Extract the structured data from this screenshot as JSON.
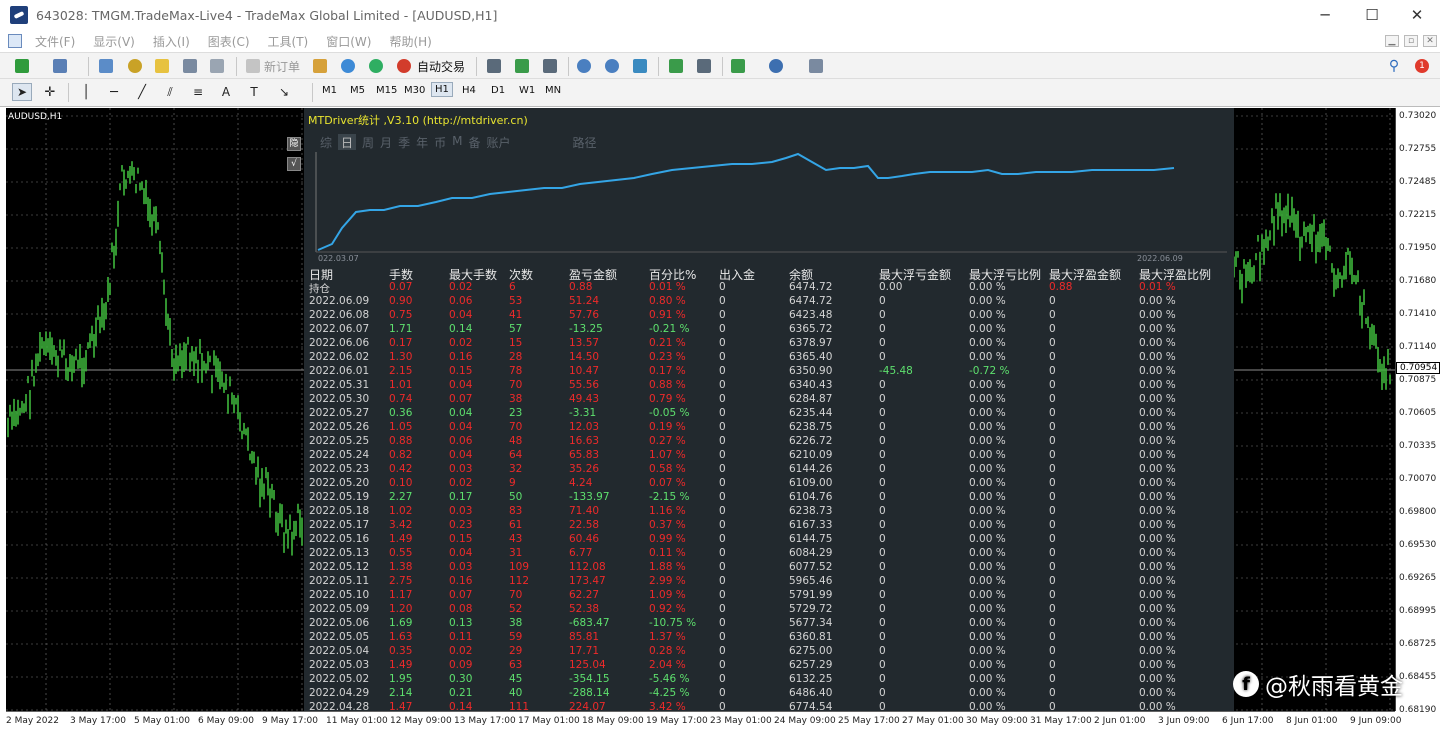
{
  "window": {
    "title": "643028: TMGM.TradeMax-Live4 - TradeMax Global Limited - [AUDUSD,H1]",
    "min": "─",
    "max": "☐",
    "close": "✕"
  },
  "menu": [
    "文件(F)",
    "显示(V)",
    "插入(I)",
    "图表(C)",
    "工具(T)",
    "窗口(W)",
    "帮助(H)"
  ],
  "toolbar": {
    "new_order": "新订单",
    "auto_trade": "自动交易",
    "notif_count": "1"
  },
  "timeframes": [
    "M1",
    "M5",
    "M15",
    "M30",
    "H1",
    "H4",
    "D1",
    "W1",
    "MN"
  ],
  "active_timeframe": "H1",
  "chart": {
    "symbol": "AUDUSD,H1",
    "current_price": "0.70954",
    "price_labels": [
      "0.73020",
      "0.72755",
      "0.72485",
      "0.72215",
      "0.71950",
      "0.71680",
      "0.71410",
      "0.71140",
      "0.70875",
      "0.70605",
      "0.70335",
      "0.70070",
      "0.69800",
      "0.69530",
      "0.69265",
      "0.68995",
      "0.68725",
      "0.68455",
      "0.68190"
    ],
    "time_labels": [
      "2 May 2022",
      "3 May 17:00",
      "5 May 01:00",
      "6 May 09:00",
      "9 May 17:00",
      "11 May 01:00",
      "12 May 09:00",
      "13 May 17:00",
      "17 May 01:00",
      "18 May 09:00",
      "19 May 17:00",
      "23 May 01:00",
      "24 May 09:00",
      "25 May 17:00",
      "27 May 01:00",
      "30 May 09:00",
      "31 May 17:00",
      "2 Jun 01:00",
      "3 Jun 09:00",
      "6 Jun 17:00",
      "8 Jun 01:00",
      "9 Jun 09:00"
    ]
  },
  "panel": {
    "title": "MTDriver统计 ,V3.10 (http://mtdriver.cn)",
    "tabs": [
      "综",
      "日",
      "周",
      "月",
      "季",
      "年",
      "币",
      "M",
      "备",
      "账户",
      "路径"
    ],
    "active_tab": "日",
    "side_buttons": [
      "隐",
      "√"
    ],
    "mini_start": "022.03.07",
    "mini_end": "2022.06.09",
    "headers": [
      "日期",
      "手数",
      "最大手数",
      "次数",
      "盈亏金额",
      "百分比%",
      "出入金",
      "余额",
      "最大浮亏金额",
      "最大浮亏比例",
      "最大浮盈金额",
      "最大浮盈比例"
    ],
    "rows": [
      [
        "持仓",
        "0.07",
        "0.02",
        "6",
        "0.88",
        "0.01 %",
        "0",
        "6474.72",
        "0.00",
        "0.00 %",
        "0.88",
        "0.01 %"
      ],
      [
        "2022.06.09",
        "0.90",
        "0.06",
        "53",
        "51.24",
        "0.80 %",
        "0",
        "6474.72",
        "0",
        "0.00 %",
        "0",
        "0.00 %"
      ],
      [
        "2022.06.08",
        "0.75",
        "0.04",
        "41",
        "57.76",
        "0.91 %",
        "0",
        "6423.48",
        "0",
        "0.00 %",
        "0",
        "0.00 %"
      ],
      [
        "2022.06.07",
        "1.71",
        "0.14",
        "57",
        "-13.25",
        "-0.21 %",
        "0",
        "6365.72",
        "0",
        "0.00 %",
        "0",
        "0.00 %"
      ],
      [
        "2022.06.06",
        "0.17",
        "0.02",
        "15",
        "13.57",
        "0.21 %",
        "0",
        "6378.97",
        "0",
        "0.00 %",
        "0",
        "0.00 %"
      ],
      [
        "2022.06.02",
        "1.30",
        "0.16",
        "28",
        "14.50",
        "0.23 %",
        "0",
        "6365.40",
        "0",
        "0.00 %",
        "0",
        "0.00 %"
      ],
      [
        "2022.06.01",
        "2.15",
        "0.15",
        "78",
        "10.47",
        "0.17 %",
        "0",
        "6350.90",
        "-45.48",
        "-0.72 %",
        "0",
        "0.00 %"
      ],
      [
        "2022.05.31",
        "1.01",
        "0.04",
        "70",
        "55.56",
        "0.88 %",
        "0",
        "6340.43",
        "0",
        "0.00 %",
        "0",
        "0.00 %"
      ],
      [
        "2022.05.30",
        "0.74",
        "0.07",
        "38",
        "49.43",
        "0.79 %",
        "0",
        "6284.87",
        "0",
        "0.00 %",
        "0",
        "0.00 %"
      ],
      [
        "2022.05.27",
        "0.36",
        "0.04",
        "23",
        "-3.31",
        "-0.05 %",
        "0",
        "6235.44",
        "0",
        "0.00 %",
        "0",
        "0.00 %"
      ],
      [
        "2022.05.26",
        "1.05",
        "0.04",
        "70",
        "12.03",
        "0.19 %",
        "0",
        "6238.75",
        "0",
        "0.00 %",
        "0",
        "0.00 %"
      ],
      [
        "2022.05.25",
        "0.88",
        "0.06",
        "48",
        "16.63",
        "0.27 %",
        "0",
        "6226.72",
        "0",
        "0.00 %",
        "0",
        "0.00 %"
      ],
      [
        "2022.05.24",
        "0.82",
        "0.04",
        "64",
        "65.83",
        "1.07 %",
        "0",
        "6210.09",
        "0",
        "0.00 %",
        "0",
        "0.00 %"
      ],
      [
        "2022.05.23",
        "0.42",
        "0.03",
        "32",
        "35.26",
        "0.58 %",
        "0",
        "6144.26",
        "0",
        "0.00 %",
        "0",
        "0.00 %"
      ],
      [
        "2022.05.20",
        "0.10",
        "0.02",
        "9",
        "4.24",
        "0.07 %",
        "0",
        "6109.00",
        "0",
        "0.00 %",
        "0",
        "0.00 %"
      ],
      [
        "2022.05.19",
        "2.27",
        "0.17",
        "50",
        "-133.97",
        "-2.15 %",
        "0",
        "6104.76",
        "0",
        "0.00 %",
        "0",
        "0.00 %"
      ],
      [
        "2022.05.18",
        "1.02",
        "0.03",
        "83",
        "71.40",
        "1.16 %",
        "0",
        "6238.73",
        "0",
        "0.00 %",
        "0",
        "0.00 %"
      ],
      [
        "2022.05.17",
        "3.42",
        "0.23",
        "61",
        "22.58",
        "0.37 %",
        "0",
        "6167.33",
        "0",
        "0.00 %",
        "0",
        "0.00 %"
      ],
      [
        "2022.05.16",
        "1.49",
        "0.15",
        "43",
        "60.46",
        "0.99 %",
        "0",
        "6144.75",
        "0",
        "0.00 %",
        "0",
        "0.00 %"
      ],
      [
        "2022.05.13",
        "0.55",
        "0.04",
        "31",
        "6.77",
        "0.11 %",
        "0",
        "6084.29",
        "0",
        "0.00 %",
        "0",
        "0.00 %"
      ],
      [
        "2022.05.12",
        "1.38",
        "0.03",
        "109",
        "112.08",
        "1.88 %",
        "0",
        "6077.52",
        "0",
        "0.00 %",
        "0",
        "0.00 %"
      ],
      [
        "2022.05.11",
        "2.75",
        "0.16",
        "112",
        "173.47",
        "2.99 %",
        "0",
        "5965.46",
        "0",
        "0.00 %",
        "0",
        "0.00 %"
      ],
      [
        "2022.05.10",
        "1.17",
        "0.07",
        "70",
        "62.27",
        "1.09 %",
        "0",
        "5791.99",
        "0",
        "0.00 %",
        "0",
        "0.00 %"
      ],
      [
        "2022.05.09",
        "1.20",
        "0.08",
        "52",
        "52.38",
        "0.92 %",
        "0",
        "5729.72",
        "0",
        "0.00 %",
        "0",
        "0.00 %"
      ],
      [
        "2022.05.06",
        "1.69",
        "0.13",
        "38",
        "-683.47",
        "-10.75 %",
        "0",
        "5677.34",
        "0",
        "0.00 %",
        "0",
        "0.00 %"
      ],
      [
        "2022.05.05",
        "1.63",
        "0.11",
        "59",
        "85.81",
        "1.37 %",
        "0",
        "6360.81",
        "0",
        "0.00 %",
        "0",
        "0.00 %"
      ],
      [
        "2022.05.04",
        "0.35",
        "0.02",
        "29",
        "17.71",
        "0.28 %",
        "0",
        "6275.00",
        "0",
        "0.00 %",
        "0",
        "0.00 %"
      ],
      [
        "2022.05.03",
        "1.49",
        "0.09",
        "63",
        "125.04",
        "2.04 %",
        "0",
        "6257.29",
        "0",
        "0.00 %",
        "0",
        "0.00 %"
      ],
      [
        "2022.05.02",
        "1.95",
        "0.30",
        "45",
        "-354.15",
        "-5.46 %",
        "0",
        "6132.25",
        "0",
        "0.00 %",
        "0",
        "0.00 %"
      ],
      [
        "2022.04.29",
        "2.14",
        "0.21",
        "40",
        "-288.14",
        "-4.25 %",
        "0",
        "6486.40",
        "0",
        "0.00 %",
        "0",
        "0.00 %"
      ],
      [
        "2022.04.28",
        "1.47",
        "0.14",
        "111",
        "224.07",
        "3.42 %",
        "0",
        "6774.54",
        "0",
        "0.00 %",
        "0",
        "0.00 %"
      ]
    ]
  },
  "watermark": "@秋雨看黄金",
  "watermark_icon": "f"
}
